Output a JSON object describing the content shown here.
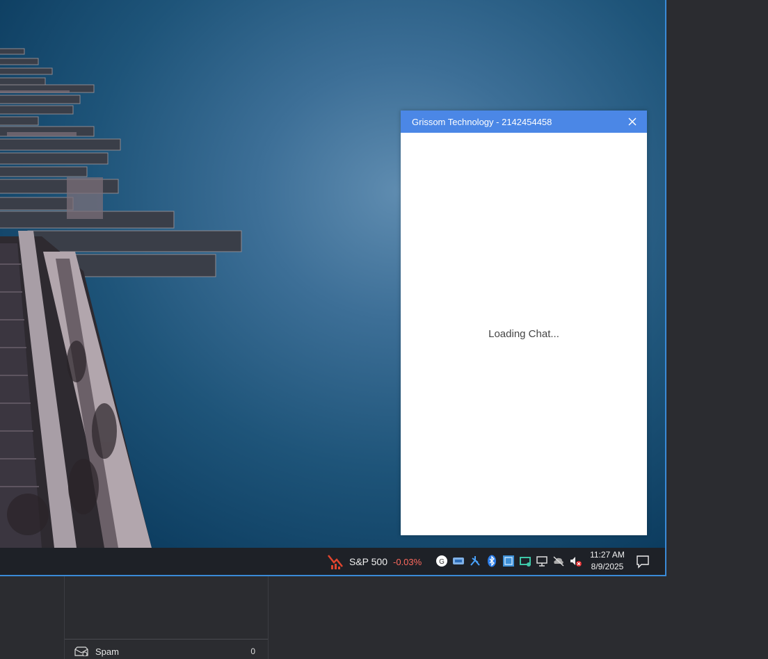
{
  "chat": {
    "title": "Grissom Technology - 2142454458",
    "loading_text": "Loading Chat..."
  },
  "taskbar": {
    "ticker_name": "S&P 500",
    "ticker_change": "-0.03%",
    "time": "11:27 AM",
    "date": "8/9/2025",
    "tray_icons": [
      "grammarly-icon",
      "onedrive-icon",
      "network-app-icon",
      "bluetooth-icon",
      "remote-app-icon",
      "vpn-icon",
      "display-icon",
      "cloud-offline-icon",
      "volume-muted-icon"
    ]
  },
  "mail_sidebar": {
    "folder_label": "Spam",
    "folder_count": "0"
  },
  "colors": {
    "chat_header": "#4b87e6",
    "window_border": "#3a8bd8",
    "ticker_negative": "#ff6a5e"
  }
}
